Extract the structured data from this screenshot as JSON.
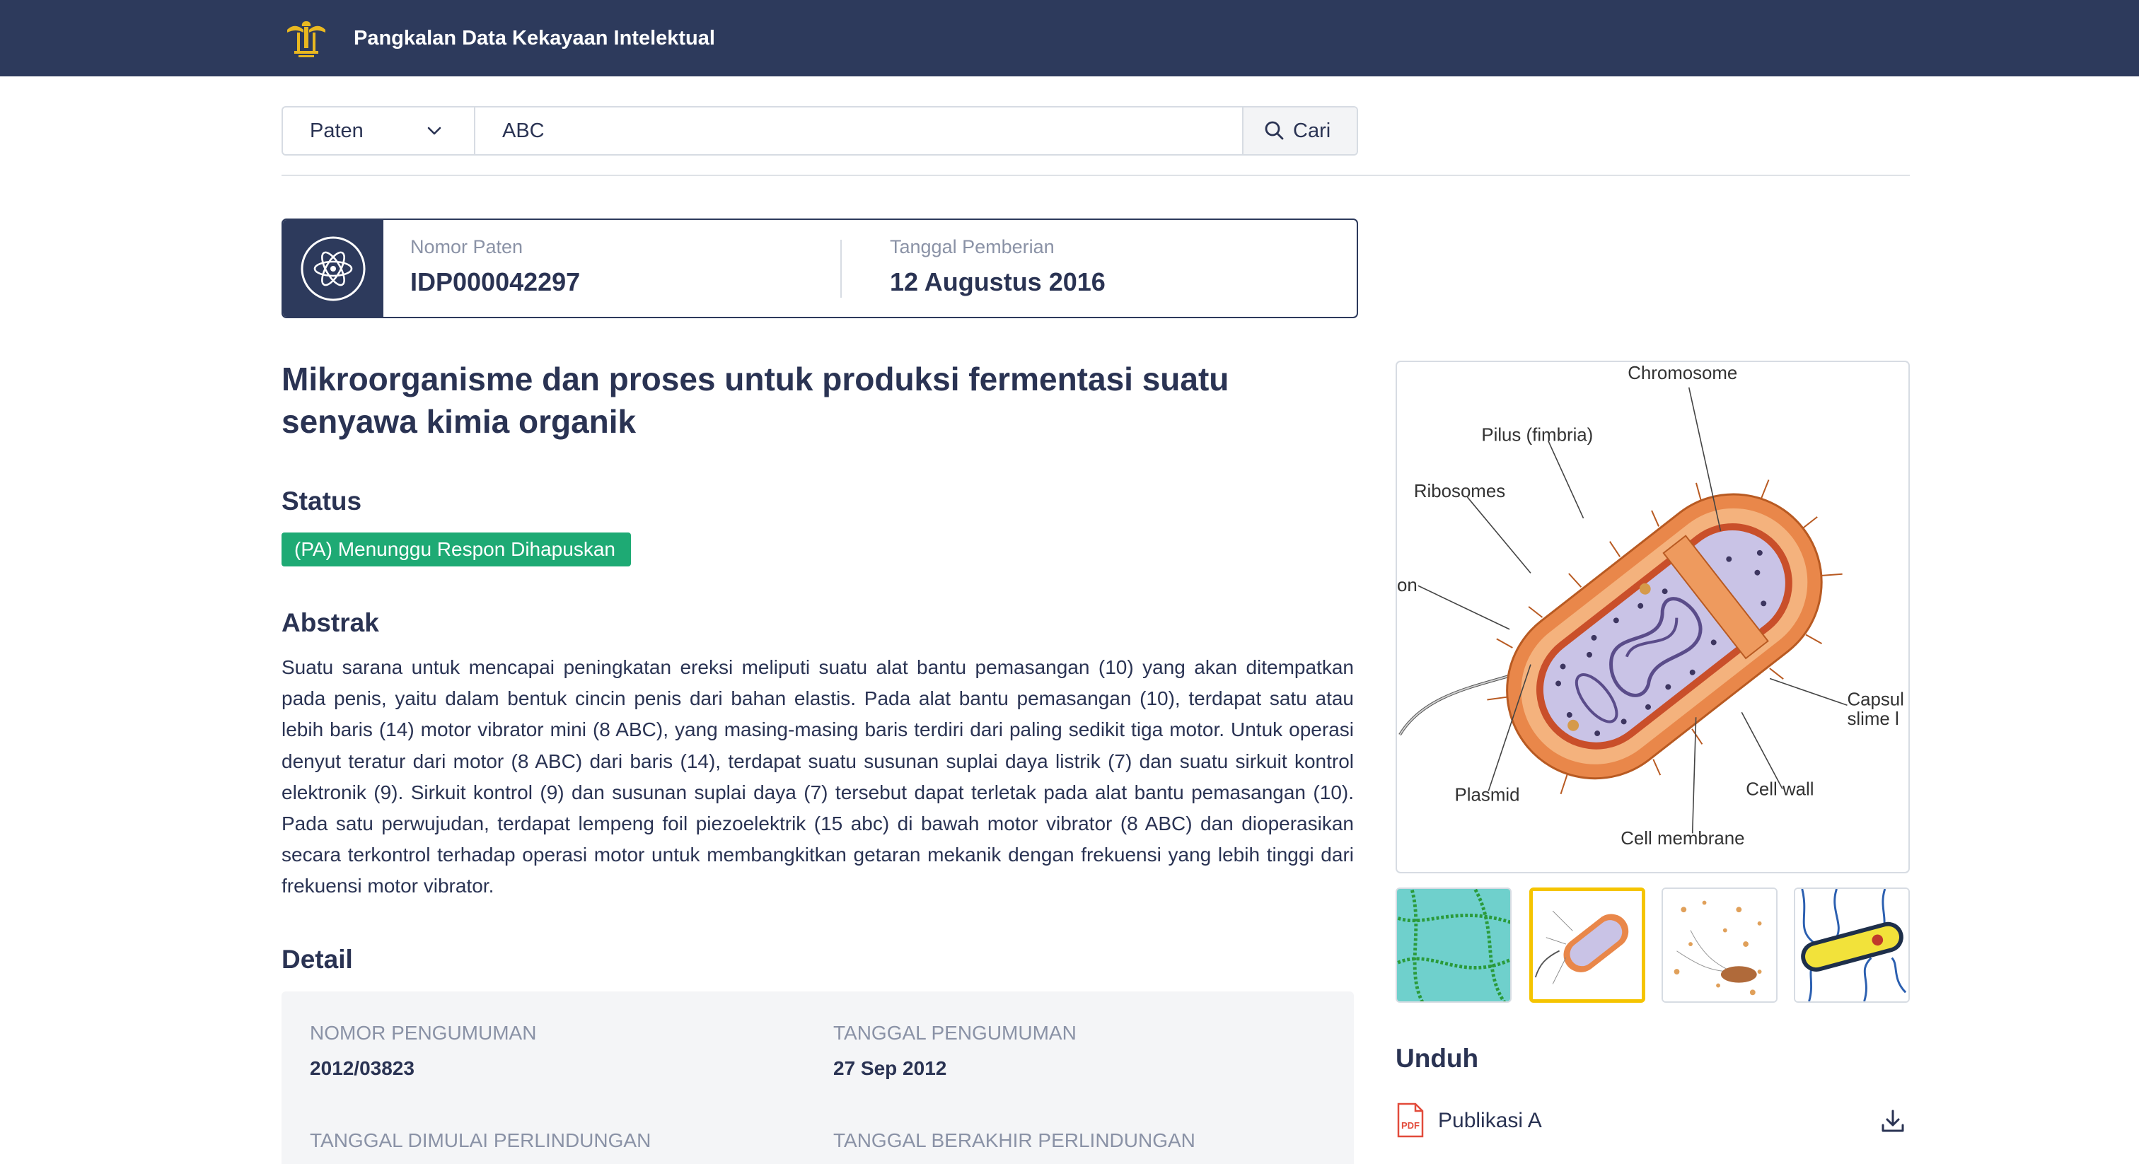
{
  "header": {
    "title": "Pangkalan Data Kekayaan Intelektual",
    "logo_icon": "garuda-emblem-icon",
    "background": "#2d3a5c"
  },
  "search": {
    "type_selected": "Paten",
    "query": "ABC",
    "button_label": "Cari"
  },
  "patent": {
    "number_label": "Nomor Paten",
    "number": "IDP000042297",
    "grant_date_label": "Tanggal Pemberian",
    "grant_date": "12 Augustus 2016",
    "icon": "atom-icon",
    "title": "Mikroorganisme dan proses untuk produksi fermentasi suatu senyawa kimia organik"
  },
  "status": {
    "heading": "Status",
    "value": "(PA) Menunggu Respon Dihapuskan",
    "color": "#1eaa74"
  },
  "abstract": {
    "heading": "Abstrak",
    "text": "Suatu sarana untuk mencapai peningkatan ereksi meliputi suatu alat bantu pemasangan (10) yang akan ditempatkan pada penis, yaitu dalam bentuk cincin penis dari bahan elastis. Pada alat bantu pemasangan (10), terdapat satu atau lebih baris (14) motor vibrator mini (8 ABC), yang masing-masing baris terdiri dari paling sedikit tiga motor. Untuk operasi denyut teratur dari motor (8 ABC) dari baris (14), terdapat suatu susunan suplai daya listrik (7) dan suatu sirkuit kontrol elektronik (9). Sirkuit kontrol (9) dan susunan suplai daya (7) tersebut dapat terletak pada alat bantu pemasangan (10). Pada satu perwujudan, terdapat lempeng foil piezoelektrik (15 abc) di bawah motor vibrator (8 ABC) dan dioperasikan secara terkontrol terhadap operasi motor untuk membangkitkan getaran mekanik dengan frekuensi yang lebih tinggi dari frekuensi motor vibrator."
  },
  "detail": {
    "heading": "Detail",
    "announcement_number_label": "NOMOR PENGUMUMAN",
    "announcement_number": "2012/03823",
    "announcement_date_label": "TANGGAL PENGUMUMAN",
    "announcement_date": "27 Sep 2012",
    "protection_start_label": "TANGGAL DIMULAI PERLINDUNGAN",
    "protection_end_label": "TANGGAL BERAKHIR PERLINDUNGAN"
  },
  "figure": {
    "labels": {
      "chromosome": "Chromosome",
      "pilus": "Pilus (fimbria)",
      "ribosomes": "Ribosomes",
      "flagellum": "on",
      "capsule1": "Capsul",
      "capsule2": "slime l",
      "plasmid": "Plasmid",
      "cell_wall": "Cell wall",
      "cell_membrane": "Cell membrane"
    },
    "thumbnails": [
      {
        "name": "thumbnail-1",
        "selected": false
      },
      {
        "name": "thumbnail-2",
        "selected": true
      },
      {
        "name": "thumbnail-3",
        "selected": false
      },
      {
        "name": "thumbnail-4",
        "selected": false
      }
    ],
    "highlight_color": "#f5c400"
  },
  "downloads": {
    "heading": "Unduh",
    "items": [
      {
        "label": "Publikasi A",
        "icon": "pdf-file-icon",
        "action_icon": "download-icon"
      }
    ]
  }
}
